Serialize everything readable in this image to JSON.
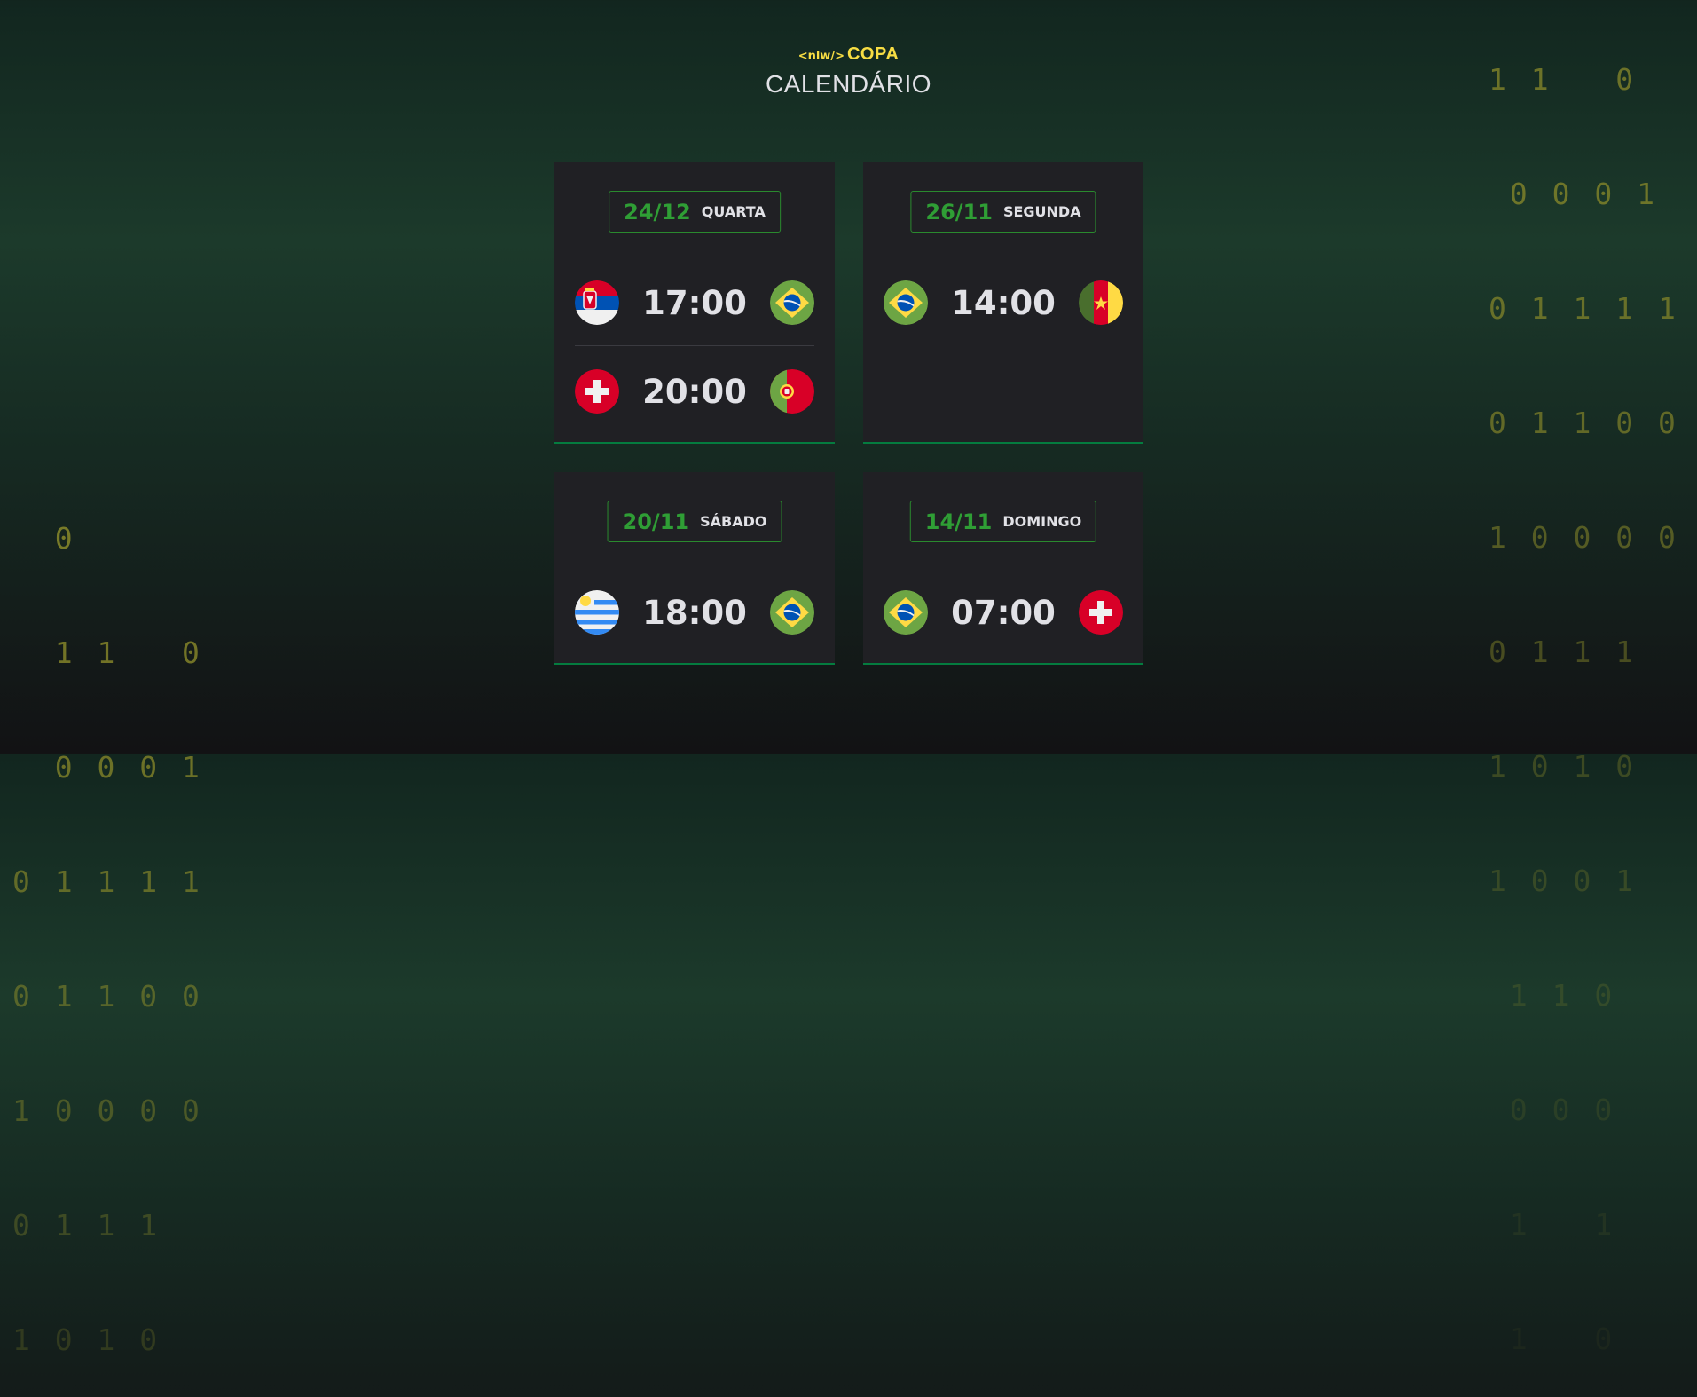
{
  "background_binary": {
    "right": [
      "1 1   0",
      " 0 0 0 1",
      "0 1 1 1 1",
      "0 1 1 0 0",
      "1 0 0 0 0",
      "0 1 1 1",
      "1 0 1 0",
      "1 0 0 1",
      " 1 1 0",
      " 0 0 0",
      " 1   1",
      " 1   0"
    ],
    "left": [
      "  0",
      "  1 1   0",
      "  0 0 0 1",
      "0 1 1 1 1",
      "0 1 1 0 0",
      "1 0 0 0 0",
      "0 1 1 1",
      "1 0 1 0"
    ]
  },
  "header": {
    "logo_tag": "<nlw/>",
    "logo_name": "COPA",
    "title": "CALENDÁRIO"
  },
  "cards": [
    {
      "date": "24/12",
      "weekday": "QUARTA",
      "matches": [
        {
          "home": "serbia-flag-icon",
          "time": "17:00",
          "away": "brazil-flag-icon"
        },
        {
          "home": "switzerland-flag-icon",
          "time": "20:00",
          "away": "portugal-flag-icon"
        }
      ]
    },
    {
      "date": "26/11",
      "weekday": "SEGUNDA",
      "matches": [
        {
          "home": "brazil-flag-icon",
          "time": "14:00",
          "away": "cameroon-flag-icon"
        }
      ]
    },
    {
      "date": "20/11",
      "weekday": "SÁBADO",
      "matches": [
        {
          "home": "uruguay-flag-icon",
          "time": "18:00",
          "away": "brazil-flag-icon"
        }
      ]
    },
    {
      "date": "14/11",
      "weekday": "DOMINGO",
      "matches": [
        {
          "home": "brazil-flag-icon",
          "time": "07:00",
          "away": "switzerland-flag-icon"
        }
      ]
    }
  ],
  "colors": {
    "accent_green": "#2f9e35",
    "brand_yellow": "#f7dd43",
    "card_bg": "#202024",
    "binary_olive": "#8a8a2a"
  }
}
